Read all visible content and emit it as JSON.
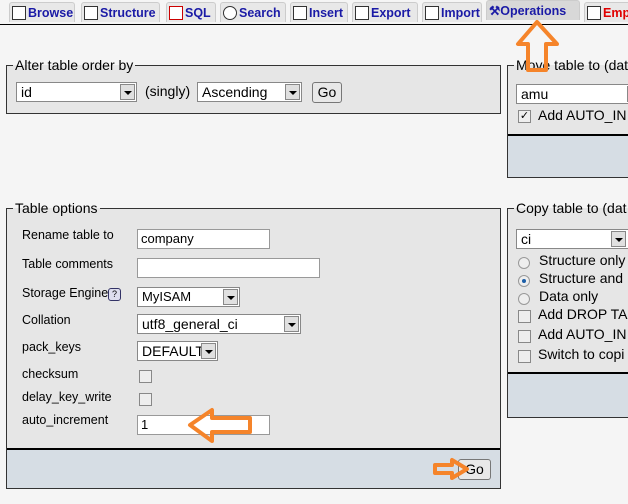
{
  "tabs": [
    {
      "label": "Browse",
      "icon": "browse-icon"
    },
    {
      "label": "Structure",
      "icon": "structure-icon"
    },
    {
      "label": "SQL",
      "icon": "sql-icon"
    },
    {
      "label": "Search",
      "icon": "search-icon"
    },
    {
      "label": "Insert",
      "icon": "insert-icon"
    },
    {
      "label": "Export",
      "icon": "export-icon"
    },
    {
      "label": "Import",
      "icon": "import-icon"
    },
    {
      "label": "Operations",
      "icon": "operations-icon",
      "active": true
    },
    {
      "label": "Empt",
      "icon": "empty-icon",
      "color": "#e00000"
    }
  ],
  "alter_order": {
    "legend": "Alter table order by",
    "column": "id",
    "singly": "(singly)",
    "direction": "Ascending",
    "go": "Go"
  },
  "move": {
    "legend": "Move table to (dat",
    "database": "amu",
    "auto_inc": "Add AUTO_IN",
    "auto_inc_checked": true
  },
  "table_options": {
    "legend": "Table options",
    "rename_label": "Rename table to",
    "rename_value": "company",
    "comments_label": "Table comments",
    "comments_value": "",
    "engine_label": "Storage Engine",
    "engine_value": "MyISAM",
    "collation_label": "Collation",
    "collation_value": "utf8_general_ci",
    "pack_keys_label": "pack_keys",
    "pack_keys_value": "DEFAULT",
    "checksum_label": "checksum",
    "checksum_checked": false,
    "delay_label": "delay_key_write",
    "delay_checked": false,
    "auto_inc_label": "auto_increment",
    "auto_inc_value": "1",
    "go": "Go"
  },
  "copy": {
    "legend": "Copy table to (dat",
    "database": "ci",
    "radios": [
      {
        "label": "Structure only",
        "checked": false
      },
      {
        "label": "Structure and",
        "checked": true
      },
      {
        "label": "Data only",
        "checked": false
      }
    ],
    "checks": [
      {
        "label": "Add DROP TA"
      },
      {
        "label": "Add AUTO_IN"
      },
      {
        "label": "Switch to copi"
      }
    ]
  },
  "annotation_color": "#f5842a"
}
